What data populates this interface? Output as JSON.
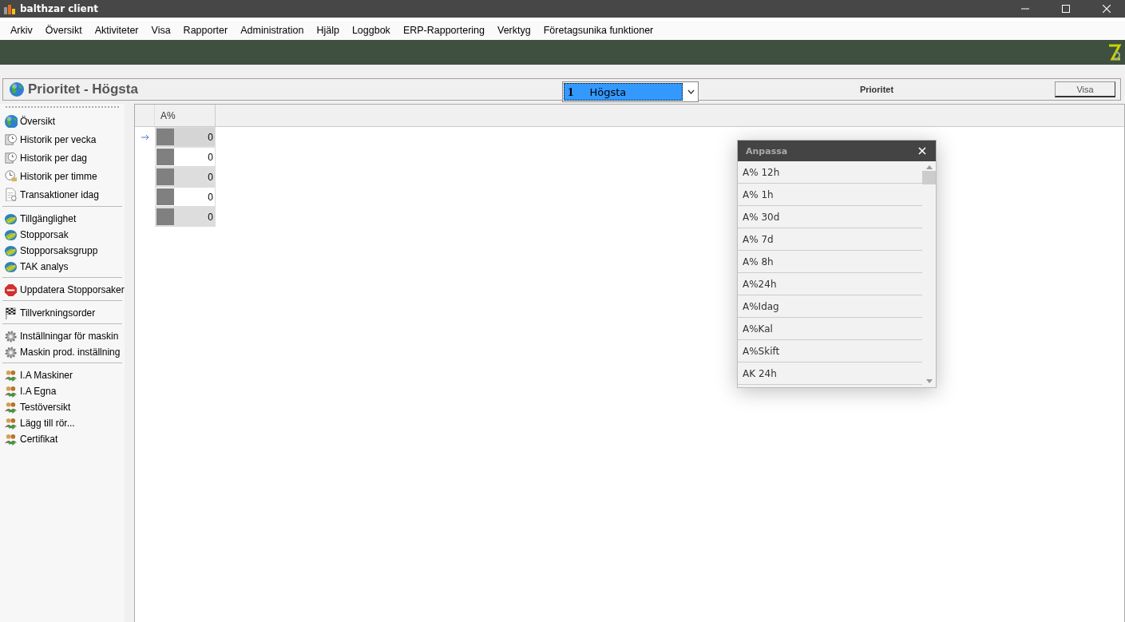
{
  "window": {
    "title": "balthzar client"
  },
  "menu": [
    "Arkiv",
    "Översikt",
    "Aktiviteter",
    "Visa",
    "Rapporter",
    "Administration",
    "Hjälp",
    "Loggbok",
    "ERP-Rapportering",
    "Verktyg",
    "Företagsunika funktioner"
  ],
  "header": {
    "title": "Prioritet - Högsta",
    "combo": {
      "code": "1",
      "value": "Högsta"
    },
    "label": "Prioritet",
    "button": "Visa"
  },
  "sidebar": {
    "groups": [
      {
        "items": [
          "Översikt",
          "Historik per vecka",
          "Historik per dag",
          "Historik per timme",
          "Transaktioner idag"
        ]
      },
      {
        "items": [
          "Tillgänglighet",
          "Stopporsak",
          "Stopporsaksgrupp",
          "TAK analys"
        ]
      },
      {
        "items": [
          "Uppdatera Stopporsaker"
        ]
      },
      {
        "items": [
          "Tillverkningsorder"
        ]
      },
      {
        "items": [
          "Inställningar för maskin",
          "Maskin prod. inställning"
        ]
      },
      {
        "items": [
          "I.A Maskiner",
          "I.A Egna",
          "Testöversikt",
          "Lägg till rör...",
          "Certifikat"
        ]
      }
    ]
  },
  "table": {
    "columns": [
      "A%"
    ],
    "rows": [
      {
        "value": "0",
        "selected": true
      },
      {
        "value": "0",
        "selected": false
      },
      {
        "value": "0",
        "selected": false
      },
      {
        "value": "0",
        "selected": false
      },
      {
        "value": "0",
        "selected": false
      }
    ]
  },
  "popup": {
    "title": "Anpassa",
    "items": [
      "A% 12h",
      "A% 1h",
      "A% 30d",
      "A% 7d",
      "A% 8h",
      "A%24h",
      "A%Idag",
      "A%Kal",
      "A%Skift",
      "AK 24h"
    ]
  }
}
